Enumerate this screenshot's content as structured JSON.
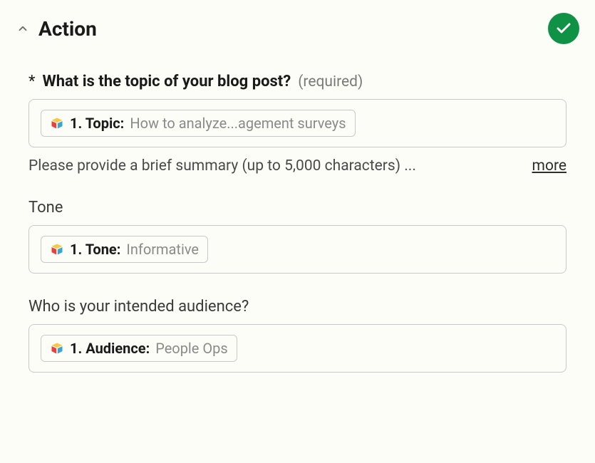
{
  "header": {
    "title": "Action",
    "status": "success"
  },
  "fields": {
    "topic": {
      "asterisk": "*",
      "label": "What is the topic of your blog post?",
      "required_text": "(required)",
      "chip_label": "1. Topic:",
      "chip_value": "How to analyze...agement surveys",
      "helper_text": "Please provide a brief summary (up to 5,000 characters) ...",
      "more_label": "more"
    },
    "tone": {
      "label": "Tone",
      "chip_label": "1. Tone:",
      "chip_value": "Informative"
    },
    "audience": {
      "label": "Who is your intended audience?",
      "chip_label": "1. Audience:",
      "chip_value": "People Ops"
    }
  }
}
